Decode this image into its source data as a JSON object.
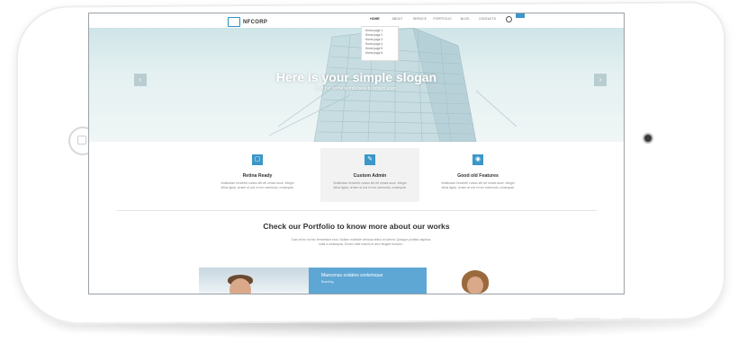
{
  "site": {
    "logo_text": "NFCORP",
    "nav": [
      "Home",
      "About",
      "Service",
      "Portfolio",
      "Blog",
      "Contacts"
    ],
    "nav_active": "Home",
    "dropdown": [
      "Home page 1",
      "Home page 2",
      "Home page 3",
      "Home page 4",
      "Home page 5",
      "Home page 6"
    ]
  },
  "hero": {
    "title": "Here is your simple slogan",
    "subtitle": "Just put some words here to inform users",
    "prev_arrow": "‹",
    "next_arrow": "›"
  },
  "features": [
    {
      "icon": "monitor-icon",
      "glyph": "▢",
      "title": "Retina Ready",
      "text": "Vestibulum hendrerit cursus elit vel ornare auue. Integer tellus ligula, ornare at orci in non commodo, consequat."
    },
    {
      "icon": "pencil-icon",
      "glyph": "✎",
      "title": "Custom Admin",
      "text": "Vestibulum hendrerit cursus elit vel ornare auue. Integer tellus ligula, ornare at orci in non commodo, consequat."
    },
    {
      "icon": "wifi-icon",
      "glyph": "◉",
      "title": "Good old Features",
      "text": "Vestibulum hendrerit cursus elit vel ornare auue. Integer tellus ligula, ornare at orci in non commodo, consequat."
    }
  ],
  "portfolio": {
    "title": "Check our Portfolio to know more about our works",
    "text": "Cras et leo mi nec fermentum eros. Nullam molestie vehicula tellus id viverra. Quisque porttitor dapibus nulla a consequat. Donec vitae mauris in arcu feugiat rhoncus.",
    "card_title": "Maecenas sodales scelerisque",
    "card_sub": "Branding"
  },
  "colors": {
    "accent": "#3b97c9",
    "hero_bg": "#d6e9ec",
    "text_dark": "#333333"
  }
}
